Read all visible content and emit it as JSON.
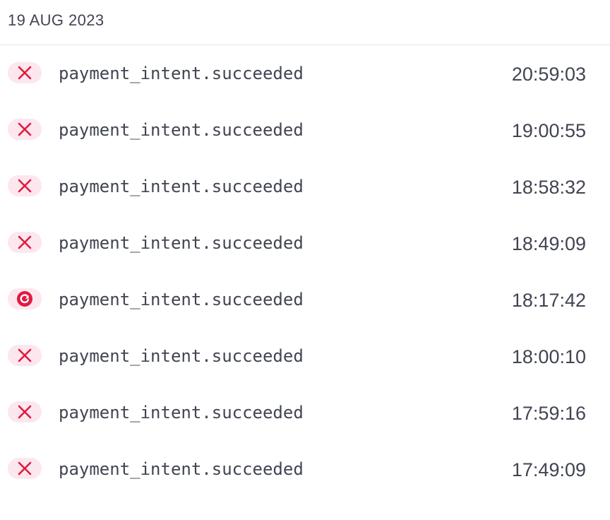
{
  "header": {
    "date": "19 AUG 2023"
  },
  "colors": {
    "failed_icon": "#df1b41",
    "pill_background": "#fde7ee",
    "text": "#414552"
  },
  "events": [
    {
      "status_icon": "close-icon",
      "type": "payment_intent.succeeded",
      "time": "20:59:03"
    },
    {
      "status_icon": "close-icon",
      "type": "payment_intent.succeeded",
      "time": "19:00:55"
    },
    {
      "status_icon": "close-icon",
      "type": "payment_intent.succeeded",
      "time": "18:58:32"
    },
    {
      "status_icon": "close-icon",
      "type": "payment_intent.succeeded",
      "time": "18:49:09"
    },
    {
      "status_icon": "retry-icon",
      "type": "payment_intent.succeeded",
      "time": "18:17:42"
    },
    {
      "status_icon": "close-icon",
      "type": "payment_intent.succeeded",
      "time": "18:00:10"
    },
    {
      "status_icon": "close-icon",
      "type": "payment_intent.succeeded",
      "time": "17:59:16"
    },
    {
      "status_icon": "close-icon",
      "type": "payment_intent.succeeded",
      "time": "17:49:09"
    }
  ]
}
